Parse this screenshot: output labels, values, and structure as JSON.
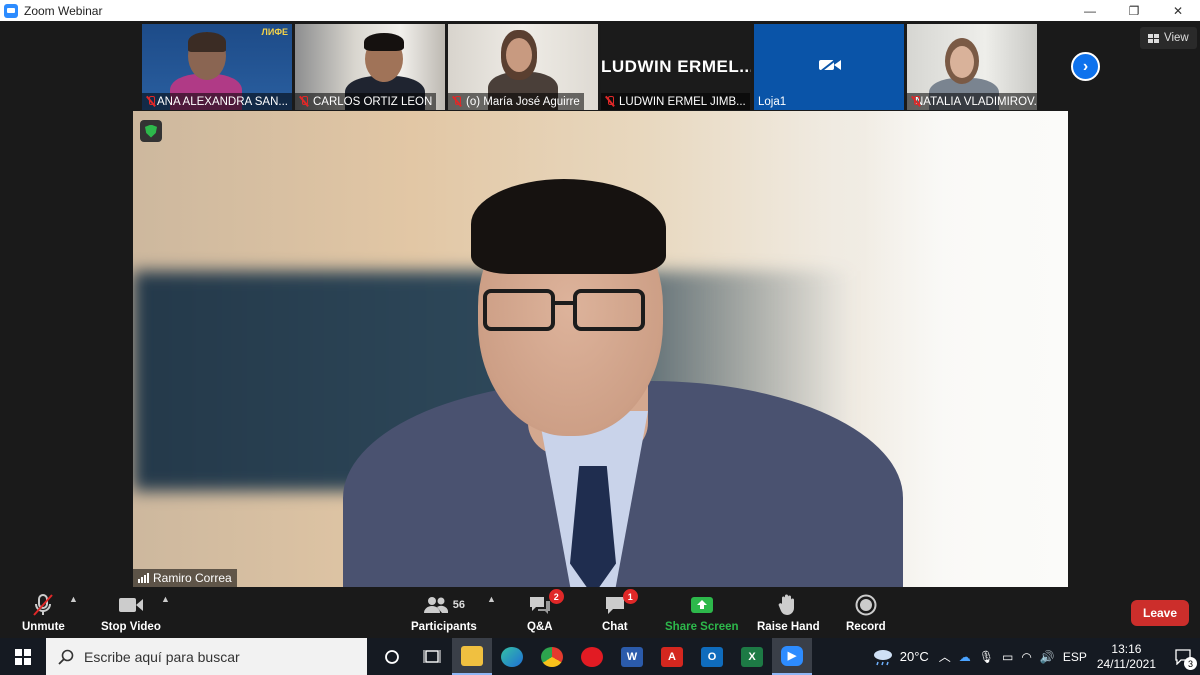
{
  "window": {
    "title": "Zoom Webinar",
    "controls": [
      "—",
      "❐",
      "✕"
    ]
  },
  "view_button": {
    "label": "View"
  },
  "thumbnails": [
    {
      "name": "ANA ALEXANDRA SAN...",
      "muted": true,
      "logo_text": "ЛИФЕ"
    },
    {
      "name": "CARLOS ORTIZ LEON",
      "muted": true
    },
    {
      "name": "(o) María José Aguirre",
      "muted": true
    },
    {
      "name": "LUDWIN ERMEL JIMB...",
      "muted": true,
      "display_name": "LUDWIN  ERMEL..."
    },
    {
      "name": "Loja1",
      "muted": false,
      "video_off": true
    },
    {
      "name": "NATALIA VLADIMIROV...",
      "muted": true
    }
  ],
  "main_video": {
    "speaker_name": "Ramiro Correa"
  },
  "toolbar": {
    "unmute": "Unmute",
    "stop_video": "Stop Video",
    "participants": "Participants",
    "participants_count": "56",
    "qa": "Q&A",
    "qa_badge": "2",
    "chat": "Chat",
    "chat_badge": "1",
    "share_screen": "Share Screen",
    "raise_hand": "Raise Hand",
    "record": "Record",
    "leave": "Leave"
  },
  "taskbar": {
    "search_placeholder": "Escribe aquí para buscar",
    "weather": "20°C",
    "language": "ESP",
    "time": "13:16",
    "date": "24/11/2021",
    "notifications": "3"
  },
  "colors": {
    "accent": "#0e72ed",
    "leave": "#cc2e2b",
    "share": "#2db84b",
    "muted": "#e02828"
  }
}
